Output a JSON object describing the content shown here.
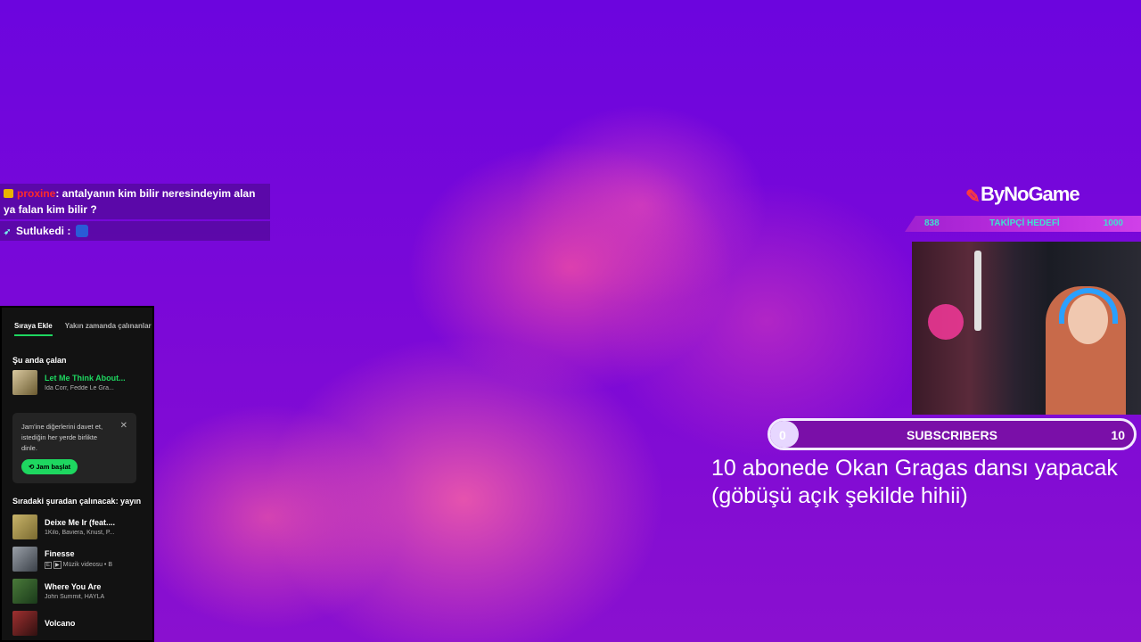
{
  "chat": {
    "messages": [
      {
        "user": "proxine",
        "text": ": antalyanın kim bilir neresindeyim alan ya falan kim bilir ?"
      },
      {
        "user": "Sutlukedi",
        "text": " : "
      }
    ]
  },
  "spotify": {
    "tabs": [
      "Sıraya Ekle",
      "Yakın zamanda çalınanlar"
    ],
    "now_playing_title": "Şu anda çalan",
    "now_playing": {
      "title": "Let Me Think About...",
      "artists": "Ida Corr, Fedde Le Gra..."
    },
    "jam": {
      "text": "Jam'ine diğerlerini davet et, istediğin her yerde birlikte dinle.",
      "button": "Jam başlat"
    },
    "queue_title": "Sıradaki şuradan çalınacak: yayın",
    "queue": [
      {
        "title": "Deixe Me Ir (feat....",
        "artists": "1Kilo, Baviera, Knust, P...",
        "badge": ""
      },
      {
        "title": "Finesse",
        "artists": "Müzik videosu • B",
        "badge": "E"
      },
      {
        "title": "Where You Are",
        "artists": "John Summit, HAYLA",
        "badge": ""
      },
      {
        "title": "Volcano",
        "artists": "",
        "badge": ""
      }
    ],
    "accent": "#1ed760"
  },
  "overlay": {
    "logo": "ByNoGame",
    "follower_goal": {
      "min": "838",
      "label": "TAKİPÇİ HEDEFİ",
      "max": "1000"
    },
    "subscribers": {
      "min": "0",
      "label": "SUBSCRIBERS",
      "max": "10",
      "progress": 0.0
    },
    "goal_line1": "10 abonede Okan Gragas dansı yapacak",
    "goal_line2": "(göbüşü açık şekilde hihii)"
  }
}
